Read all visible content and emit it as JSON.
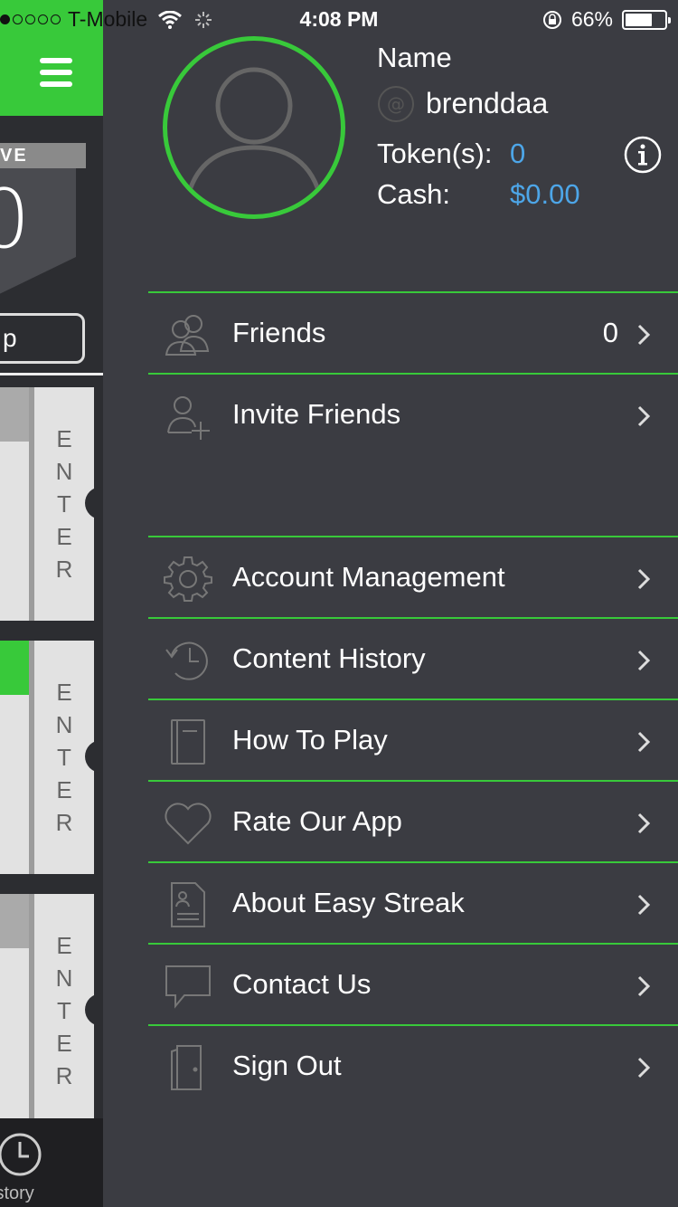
{
  "status_bar": {
    "carrier": "T-Mobile",
    "time": "4:08 PM",
    "battery": "66%",
    "battery_level": 0.66,
    "signal_bars": 1
  },
  "left_panel": {
    "ribbon_text": "VE",
    "big_number": "0",
    "button_text": "p",
    "cards": [
      {
        "enter_text": [
          "E",
          "N",
          "T",
          "E",
          "R"
        ],
        "top_color": "#aaaaaa"
      },
      {
        "enter_text": [
          "E",
          "N",
          "T",
          "E",
          "R"
        ],
        "top_color": "#38c93a"
      },
      {
        "enter_text": [
          "E",
          "N",
          "T",
          "E",
          "R"
        ],
        "top_color": "#aaaaaa"
      }
    ],
    "tab_label": "istory"
  },
  "profile": {
    "name_label": "Name",
    "username": "brenddaa",
    "token_label": "Token(s):",
    "token_value": "0",
    "cash_label": "Cash:",
    "cash_value": "$0.00"
  },
  "menu": {
    "items": [
      {
        "label": "Friends",
        "count": "0",
        "icon": "friends-icon"
      },
      {
        "label": "Invite Friends",
        "count": "",
        "icon": "invite-friends-icon"
      },
      {
        "label": "Account Management",
        "count": "",
        "icon": "gear-icon"
      },
      {
        "label": "Content History",
        "count": "",
        "icon": "history-icon"
      },
      {
        "label": "How To Play",
        "count": "",
        "icon": "book-icon"
      },
      {
        "label": "Rate Our App",
        "count": "",
        "icon": "heart-icon"
      },
      {
        "label": "About Easy Streak",
        "count": "",
        "icon": "document-icon"
      },
      {
        "label": "Contact Us",
        "count": "",
        "icon": "chat-bubble-icon"
      },
      {
        "label": "Sign Out",
        "count": "",
        "icon": "door-icon"
      }
    ]
  },
  "colors": {
    "accent_green": "#38c93a",
    "value_blue": "#4da6e8",
    "menu_bg": "#3b3c42"
  }
}
